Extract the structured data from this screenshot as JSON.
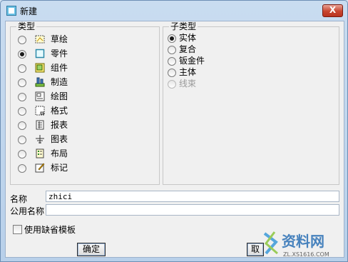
{
  "window": {
    "title": "新建",
    "close_label": "X"
  },
  "type_group": {
    "title": "类型",
    "items": [
      {
        "label": "草绘",
        "icon": "sketch-icon",
        "checked": false
      },
      {
        "label": "零件",
        "icon": "part-icon",
        "checked": true
      },
      {
        "label": "组件",
        "icon": "assembly-icon",
        "checked": false
      },
      {
        "label": "制造",
        "icon": "manufacturing-icon",
        "checked": false
      },
      {
        "label": "绘图",
        "icon": "drawing-icon",
        "checked": false
      },
      {
        "label": "格式",
        "icon": "format-icon",
        "checked": false
      },
      {
        "label": "报表",
        "icon": "report-icon",
        "checked": false
      },
      {
        "label": "图表",
        "icon": "diagram-icon",
        "checked": false
      },
      {
        "label": "布局",
        "icon": "layout-icon",
        "checked": false
      },
      {
        "label": "标记",
        "icon": "markup-icon",
        "checked": false
      }
    ]
  },
  "subtype_group": {
    "title": "子类型",
    "items": [
      {
        "label": "实体",
        "checked": true,
        "disabled": false
      },
      {
        "label": "复合",
        "checked": false,
        "disabled": false
      },
      {
        "label": "钣金件",
        "checked": false,
        "disabled": false
      },
      {
        "label": "主体",
        "checked": false,
        "disabled": false
      },
      {
        "label": "线束",
        "checked": false,
        "disabled": true
      }
    ]
  },
  "name": {
    "label": "名称",
    "value": "zhici"
  },
  "common_name": {
    "label": "公用名称",
    "value": ""
  },
  "use_default_template": {
    "label": "使用缺省模板",
    "checked": false
  },
  "buttons": {
    "ok": "确定",
    "cancel": "取"
  },
  "watermark": {
    "text": "资料网",
    "url_text": "ZL.XS1616.COM"
  }
}
